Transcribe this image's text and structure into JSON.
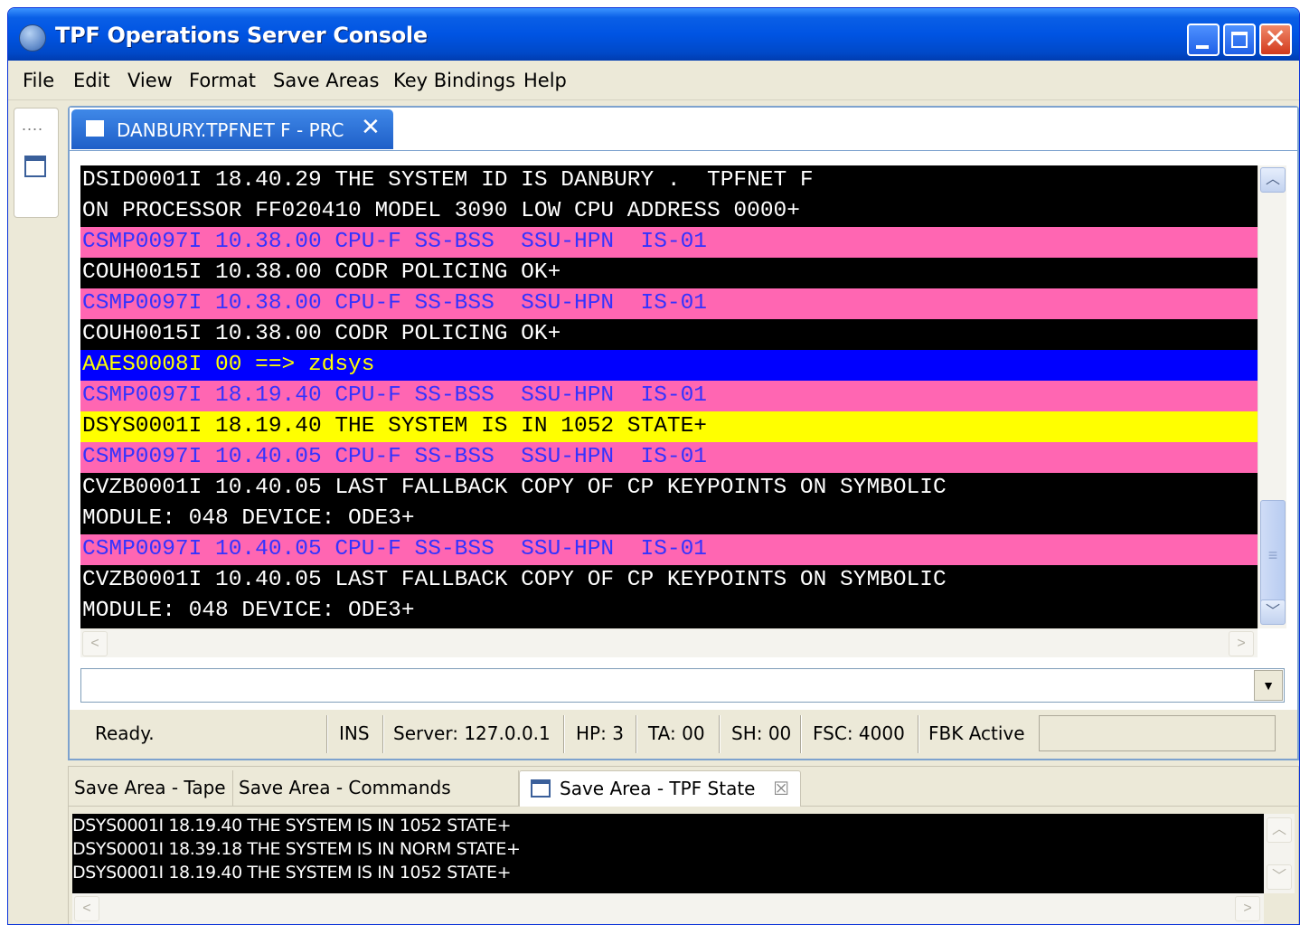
{
  "window": {
    "title": "TPF Operations Server Console"
  },
  "menu": [
    "File",
    "Edit",
    "View",
    "Format",
    "Save Areas",
    "Key Bindings",
    "Help"
  ],
  "sidebar": {
    "dots": "....",
    "icon": "window-icon"
  },
  "editor_tab": {
    "label": "DANBURY.TPFNET F - PRC",
    "close_glyph": "✕"
  },
  "console": {
    "lines": [
      {
        "text": "DSID0001I 18.40.29 THE SYSTEM ID IS DANBURY .  TPFNET F",
        "bg": "#000000",
        "fg": "#ffffff"
      },
      {
        "text": "ON PROCESSOR FF020410 MODEL 3090 LOW CPU ADDRESS 0000+",
        "bg": "#000000",
        "fg": "#ffffff"
      },
      {
        "text": "CSMP0097I 10.38.00 CPU-F SS-BSS  SSU-HPN  IS-01",
        "bg": "#ff66b2",
        "fg": "#3333ff"
      },
      {
        "text": "COUH0015I 10.38.00 CODR POLICING OK+",
        "bg": "#000000",
        "fg": "#ffffff"
      },
      {
        "text": "CSMP0097I 10.38.00 CPU-F SS-BSS  SSU-HPN  IS-01",
        "bg": "#ff66b2",
        "fg": "#3333ff"
      },
      {
        "text": "COUH0015I 10.38.00 CODR POLICING OK+",
        "bg": "#000000",
        "fg": "#ffffff"
      },
      {
        "text": "AAES0008I 00 ==> zdsys",
        "bg": "#0000ff",
        "fg": "#ffff00"
      },
      {
        "text": "CSMP0097I 18.19.40 CPU-F SS-BSS  SSU-HPN  IS-01",
        "bg": "#ff66b2",
        "fg": "#3333ff"
      },
      {
        "text": "DSYS0001I 18.19.40 THE SYSTEM IS IN 1052 STATE+",
        "bg": "#ffff00",
        "fg": "#000000"
      },
      {
        "text": "CSMP0097I 10.40.05 CPU-F SS-BSS  SSU-HPN  IS-01",
        "bg": "#ff66b2",
        "fg": "#3333ff"
      },
      {
        "text": "CVZB0001I 10.40.05 LAST FALLBACK COPY OF CP KEYPOINTS ON SYMBOLIC",
        "bg": "#000000",
        "fg": "#ffffff"
      },
      {
        "text": "MODULE: 048 DEVICE: ODE3+",
        "bg": "#000000",
        "fg": "#ffffff"
      },
      {
        "text": "CSMP0097I 10.40.05 CPU-F SS-BSS  SSU-HPN  IS-01",
        "bg": "#ff66b2",
        "fg": "#3333ff"
      },
      {
        "text": "CVZB0001I 10.40.05 LAST FALLBACK COPY OF CP KEYPOINTS ON SYMBOLIC",
        "bg": "#000000",
        "fg": "#ffffff"
      },
      {
        "text": "MODULE: 048 DEVICE: ODE3+",
        "bg": "#000000",
        "fg": "#ffffff"
      }
    ]
  },
  "command_input": {
    "value": "",
    "placeholder": ""
  },
  "status": {
    "ready": "Ready.",
    "mode": "INS",
    "server": "Server: 127.0.0.1",
    "hp": "HP: 3",
    "ta": "TA: 00",
    "sh": "SH: 00",
    "fsc": "FSC: 4000",
    "fbk": "FBK Active"
  },
  "save_area": {
    "tabs": [
      {
        "label": "Save Area - Tape",
        "active": false
      },
      {
        "label": "Save Area - Commands Echoes",
        "active": false
      },
      {
        "label": "Save Area - TPF State",
        "active": true
      }
    ],
    "close_glyph": "☒",
    "lines": [
      "DSYS0001I 18.19.40 THE SYSTEM IS IN 1052 STATE+",
      "DSYS0001I 18.39.18 THE SYSTEM IS IN NORM STATE+",
      "DSYS0001I 18.19.40 THE SYSTEM IS IN 1052 STATE+"
    ]
  },
  "colors": {
    "titlebar": "#0054e3",
    "console_bg": "#000000",
    "pink_row": "#ff66b2",
    "blue_row": "#0000ff",
    "yellow_row": "#ffff00",
    "tab_active": "#2f72d8"
  }
}
